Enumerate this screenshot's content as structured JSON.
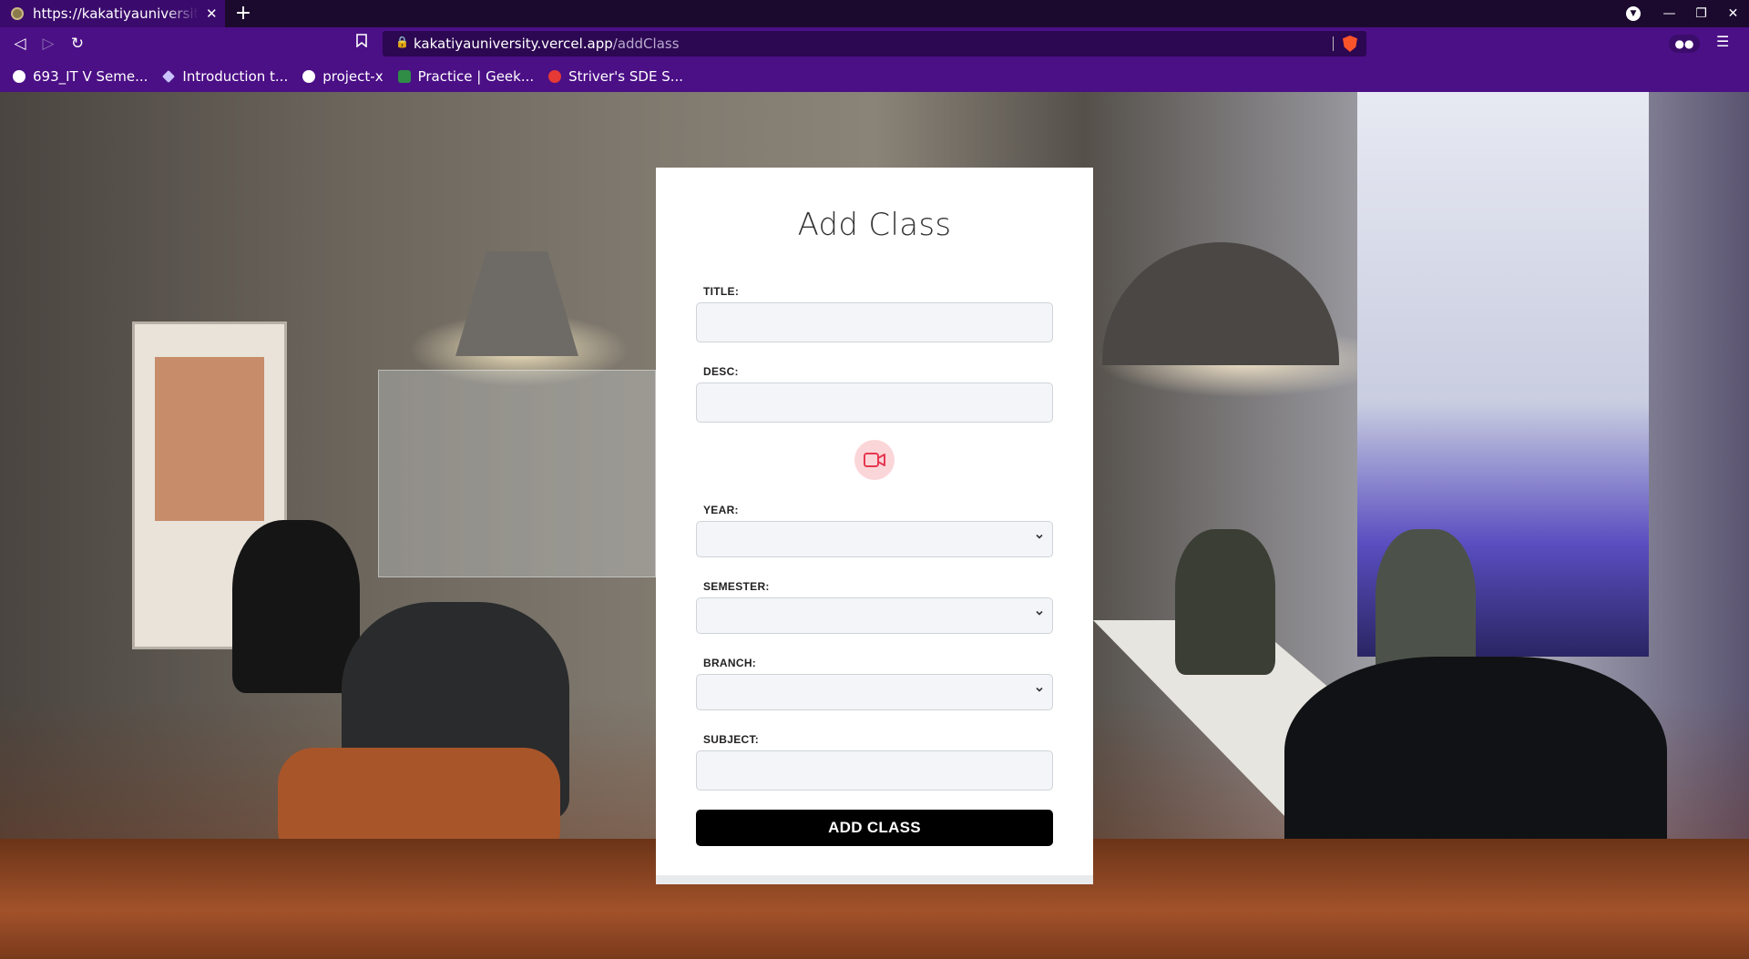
{
  "browser": {
    "tab_title": "https://kakatiyauniversity",
    "new_tab_label": "+",
    "url_host": "kakatiyauniversity.vercel.app",
    "url_path": "/addClass",
    "bookmarks": [
      {
        "label": "693_IT V Seme...",
        "color": "#ffffff"
      },
      {
        "label": "Introduction t...",
        "color": "#c9c2ff"
      },
      {
        "label": "project-x",
        "color": "#ffffff"
      },
      {
        "label": "Practice | Geek...",
        "color": "#2f8d46"
      },
      {
        "label": "Striver's SDE S...",
        "color": "#e53935"
      }
    ]
  },
  "form": {
    "title": "Add Class",
    "title_label": "TITLE:",
    "title_value": "",
    "desc_label": "DESC:",
    "desc_value": "",
    "year_label": "YEAR:",
    "year_value": "",
    "semester_label": "SEMESTER:",
    "semester_value": "",
    "branch_label": "BRANCH:",
    "branch_value": "",
    "subject_label": "SUBJECT:",
    "subject_value": "",
    "submit_label": "ADD CLASS",
    "video_icon": "video-camera-icon",
    "accent_color": "#e53950"
  }
}
